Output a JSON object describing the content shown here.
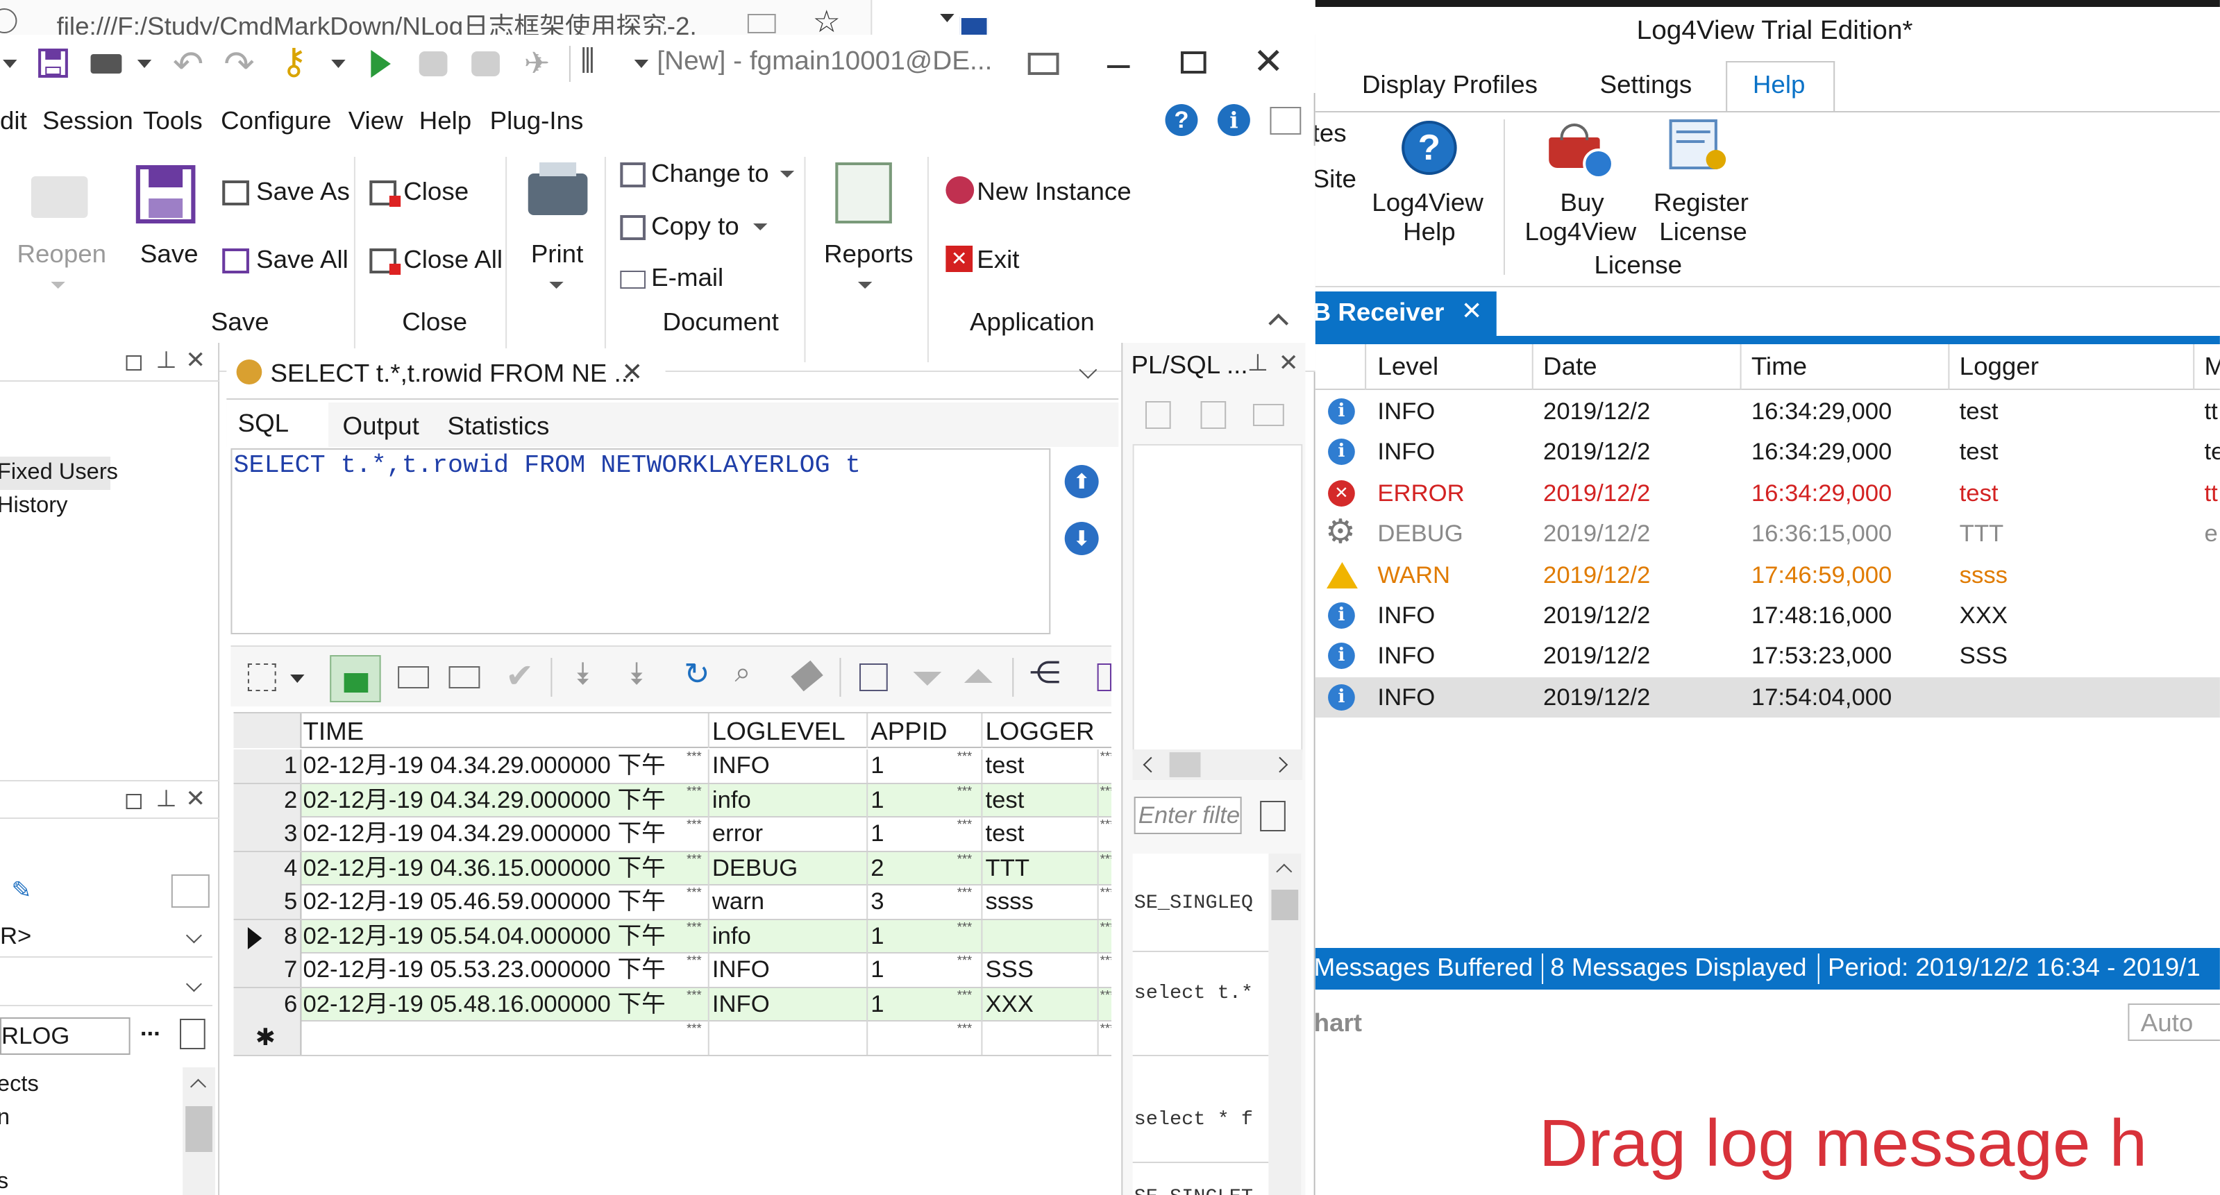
{
  "browser": {
    "url": "file:///F:/Study/CmdMarkDown/NLog日志框架使用探究-2."
  },
  "plsql": {
    "title": "[New] - fgmain10001@DE...",
    "menu": [
      "dit",
      "Session",
      "Tools",
      "Configure",
      "View",
      "Help",
      "Plug-Ins"
    ],
    "ribbon": {
      "reopen": "Reopen",
      "save": "Save",
      "save_as": "Save As",
      "save_all": "Save All",
      "close": "Close",
      "close_all": "Close All",
      "print": "Print",
      "change_to": "Change to",
      "copy_to": "Copy to",
      "email": "E-mail",
      "reports": "Reports",
      "new_instance": "New Instance",
      "exit": "Exit",
      "groups": {
        "save": "Save",
        "close": "Close",
        "document": "Document",
        "application": "Application"
      }
    },
    "left_panel": {
      "items": [
        "Fixed Users",
        "History"
      ],
      "combo1": "R>",
      "filter_text": "RLOG",
      "tree_items": [
        "ects",
        "n",
        "s"
      ]
    },
    "query_tab": {
      "title": "SELECT t.*,t.rowid FROM NE ...",
      "close": "✕"
    },
    "subtabs": [
      "SQL",
      "Output",
      "Statistics"
    ],
    "sql_text": "SELECT t.*,t.rowid FROM NETWORKLAYERLOG t",
    "grid": {
      "columns": [
        "TIME",
        "LOGLEVEL",
        "APPID",
        "LOGGER"
      ],
      "ellipsis": "***",
      "rows": [
        {
          "num": "1",
          "time": "02-12月-19 04.34.29.000000 下午",
          "level": "INFO",
          "appid": "1",
          "logger": "test"
        },
        {
          "num": "2",
          "time": "02-12月-19 04.34.29.000000 下午",
          "level": "info",
          "appid": "1",
          "logger": "test"
        },
        {
          "num": "3",
          "time": "02-12月-19 04.34.29.000000 下午",
          "level": "error",
          "appid": "1",
          "logger": "test"
        },
        {
          "num": "4",
          "time": "02-12月-19 04.36.15.000000 下午",
          "level": "DEBUG",
          "appid": "2",
          "logger": "TTT"
        },
        {
          "num": "5",
          "time": "02-12月-19 05.46.59.000000 下午",
          "level": "warn",
          "appid": "3",
          "logger": "ssss"
        },
        {
          "num": "8",
          "time": "02-12月-19 05.54.04.000000 下午",
          "level": "info",
          "appid": "1",
          "logger": ""
        },
        {
          "num": "7",
          "time": "02-12月-19 05.53.23.000000 下午",
          "level": "INFO",
          "appid": "1",
          "logger": "SSS"
        },
        {
          "num": "6",
          "time": "02-12月-19 05.48.16.000000 下午",
          "level": "INFO",
          "appid": "1",
          "logger": "XXX"
        }
      ],
      "new_row_marker": "✱"
    },
    "side_panel": {
      "title": "PL/SQL ...",
      "filter_placeholder": "Enter filte",
      "snippets": [
        "SE_SINGLEQ",
        "select t.*",
        "select * f",
        "SE_SINGLET"
      ]
    }
  },
  "log4view": {
    "title": "Log4View Trial Edition*",
    "tabs": [
      "Display Profiles",
      "Settings",
      "Help"
    ],
    "partial_left": [
      "tes",
      "Site"
    ],
    "help_button": {
      "line1": "Log4View",
      "line2": "Help"
    },
    "buy_button": {
      "line1": "Buy",
      "line2": "Log4View"
    },
    "register_button": {
      "line1": "Register",
      "line2": "License"
    },
    "group_label": "License",
    "receiver_tab": "B Receiver",
    "receiver_close": "✕",
    "columns": [
      "Level",
      "Date",
      "Time",
      "Logger",
      "M"
    ],
    "rows": [
      {
        "level": "INFO",
        "date": "2019/12/2",
        "time": "16:34:29,000",
        "logger": "test",
        "msg": "tt",
        "kind": "info"
      },
      {
        "level": "INFO",
        "date": "2019/12/2",
        "time": "16:34:29,000",
        "logger": "test",
        "msg": "te",
        "kind": "info"
      },
      {
        "level": "ERROR",
        "date": "2019/12/2",
        "time": "16:34:29,000",
        "logger": "test",
        "msg": "tt",
        "kind": "error"
      },
      {
        "level": "DEBUG",
        "date": "2019/12/2",
        "time": "16:36:15,000",
        "logger": "TTT",
        "msg": "e",
        "kind": "debug"
      },
      {
        "level": "WARN",
        "date": "2019/12/2",
        "time": "17:46:59,000",
        "logger": "ssss",
        "msg": "",
        "kind": "warn"
      },
      {
        "level": "INFO",
        "date": "2019/12/2",
        "time": "17:48:16,000",
        "logger": "XXX",
        "msg": "",
        "kind": "info"
      },
      {
        "level": "INFO",
        "date": "2019/12/2",
        "time": "17:53:23,000",
        "logger": "SSS",
        "msg": "",
        "kind": "info"
      },
      {
        "level": "INFO",
        "date": "2019/12/2",
        "time": "17:54:04,000",
        "logger": "",
        "msg": "",
        "kind": "info"
      }
    ],
    "status": {
      "buffered": "Messages Buffered",
      "displayed": "8 Messages Displayed",
      "period": "Period: 2019/12/2 16:34 - 2019/1"
    },
    "chart_label": "hart",
    "auto_label": "Auto",
    "drag_hint": "Drag log message h"
  },
  "colors": {
    "accent_blue": "#0a72c7",
    "error_red": "#d32222",
    "warn_orange": "#e07b00",
    "debug_gray": "#8a8a8a",
    "grid_green": "#e6f9e1",
    "sql_blue": "#1f3ea8"
  }
}
